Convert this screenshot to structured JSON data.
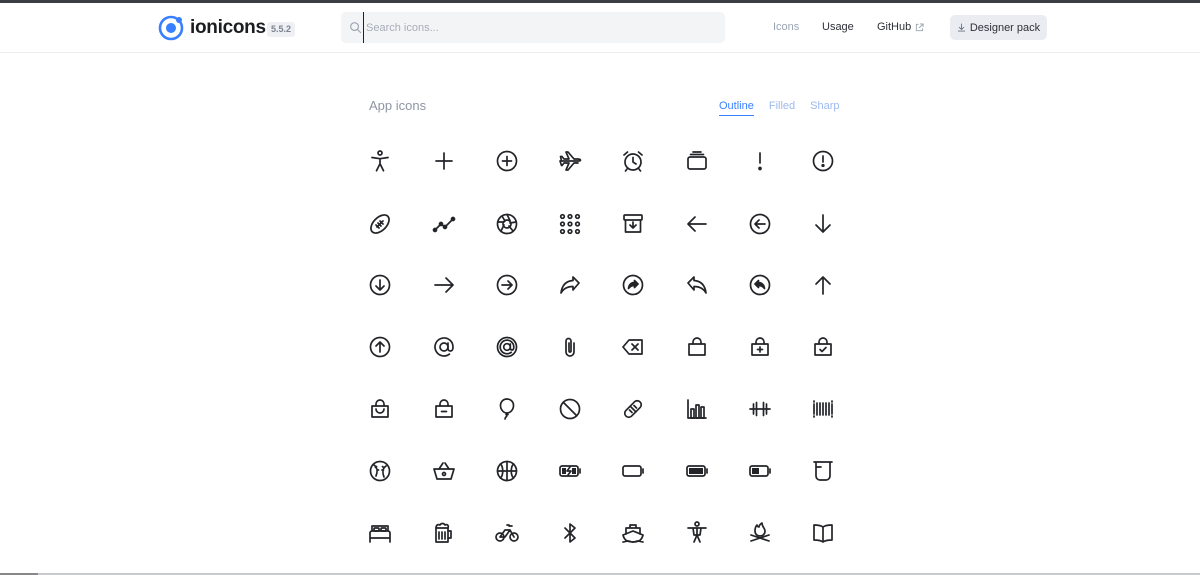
{
  "header": {
    "logo_text": "ionicons",
    "version": "5.5.2",
    "search": {
      "placeholder": "Search icons...",
      "value": ""
    },
    "nav": [
      {
        "label": "Icons",
        "active": true
      },
      {
        "label": "Usage",
        "active": false
      },
      {
        "label": "GitHub",
        "active": false
      }
    ],
    "designer_button": "Designer pack"
  },
  "section": {
    "title": "App icons",
    "tabs": [
      {
        "label": "Outline",
        "active": true
      },
      {
        "label": "Filled",
        "active": false
      },
      {
        "label": "Sharp",
        "active": false
      }
    ]
  },
  "colors": {
    "accent": "#3880ff",
    "text": "#222428",
    "muted": "#8f96a3"
  },
  "icons": [
    [
      "accessibility-icon",
      "add-icon",
      "add-circle-icon",
      "airplane-icon",
      "alarm-icon",
      "albums-icon",
      "alert-icon",
      "alert-circle-icon"
    ],
    [
      "american-football-icon",
      "analytics-icon",
      "aperture-icon",
      "apps-icon",
      "archive-icon",
      "arrow-back-icon",
      "arrow-back-circle-icon",
      "arrow-down-icon"
    ],
    [
      "arrow-down-circle-icon",
      "arrow-forward-icon",
      "arrow-forward-circle-icon",
      "arrow-redo-icon",
      "arrow-redo-circle-icon",
      "arrow-undo-icon",
      "arrow-undo-circle-icon",
      "arrow-up-icon"
    ],
    [
      "arrow-up-circle-icon",
      "at-icon",
      "at-circle-icon",
      "attach-icon",
      "backspace-icon",
      "bag-icon",
      "bag-add-icon",
      "bag-check-icon"
    ],
    [
      "bag-handle-icon",
      "bag-remove-icon",
      "balloon-icon",
      "ban-icon",
      "bandage-icon",
      "bar-chart-icon",
      "barbell-icon",
      "barcode-icon"
    ],
    [
      "baseball-icon",
      "basket-icon",
      "basketball-icon",
      "battery-charging-icon",
      "battery-dead-icon",
      "battery-full-icon",
      "battery-half-icon",
      "beaker-icon"
    ],
    [
      "bed-icon",
      "beer-icon",
      "bicycle-icon",
      "bluetooth-icon",
      "boat-icon",
      "body-icon",
      "bonfire-icon",
      "book-icon"
    ]
  ]
}
